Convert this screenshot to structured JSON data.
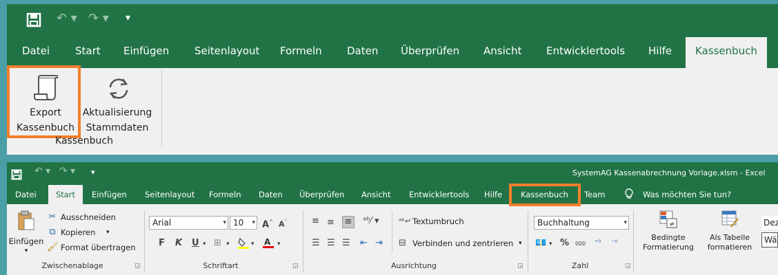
{
  "top_ribbon": {
    "tabs": [
      "Datei",
      "Start",
      "Einfügen",
      "Seitenlayout",
      "Formeln",
      "Daten",
      "Überprüfen",
      "Ansicht",
      "Entwicklertools",
      "Hilfe",
      "Kassenbuch"
    ],
    "active_tab": "Kassenbuch",
    "buttons": {
      "export_line1": "Export",
      "export_line2": "Kassenbuch",
      "refresh_line1": "Aktualisierung",
      "refresh_line2": "Stammdaten"
    },
    "group_label": "Kassenbuch"
  },
  "bottom_ribbon": {
    "title": "SystemAG Kassenabrechnung Vorlage.xlsm  -  Excel",
    "tabs": [
      "Datei",
      "Start",
      "Einfügen",
      "Seitenlayout",
      "Formeln",
      "Daten",
      "Überprüfen",
      "Ansicht",
      "Entwicklertools",
      "Hilfe",
      "Kassenbuch",
      "Team"
    ],
    "active_tab": "Start",
    "tell_me": "Was möchten Sie tun?",
    "clipboard": {
      "paste": "Einfügen",
      "cut": "Ausschneiden",
      "copy": "Kopieren",
      "format_painter": "Format übertragen",
      "label": "Zwischenablage"
    },
    "font": {
      "name": "Arial",
      "size": "10",
      "bold": "F",
      "italic": "K",
      "underline": "U",
      "grow": "A",
      "shrink": "A",
      "label": "Schriftart"
    },
    "alignment": {
      "wrap": "Textumbruch",
      "merge": "Verbinden und zentrieren",
      "label": "Ausrichtung"
    },
    "number": {
      "format": "Buchhaltung",
      "percent": "%",
      "thousands": "000",
      "inc_decimal": "⁺⁰",
      "dec_decimal": "⁻⁰",
      "label": "Zahl"
    },
    "styles": {
      "conditional_line1": "Bedingte",
      "conditional_line2": "Formatierung",
      "table_line1": "Als Tabelle",
      "table_line2": "formatieren",
      "style_top": "Dezi",
      "style_bottom": "Wäh"
    }
  },
  "colors": {
    "excel_green": "#217346",
    "highlight_orange": "#f47e2a",
    "ribbon_bg": "#f0f0f0",
    "frame_teal": "#4a9ea6"
  },
  "icons": [
    "save-icon",
    "undo-icon",
    "redo-icon",
    "customize-qat-icon",
    "scroll-icon",
    "refresh-icon",
    "lightbulb-icon",
    "paste-icon",
    "scissors-icon",
    "copy-icon",
    "format-painter-icon"
  ]
}
